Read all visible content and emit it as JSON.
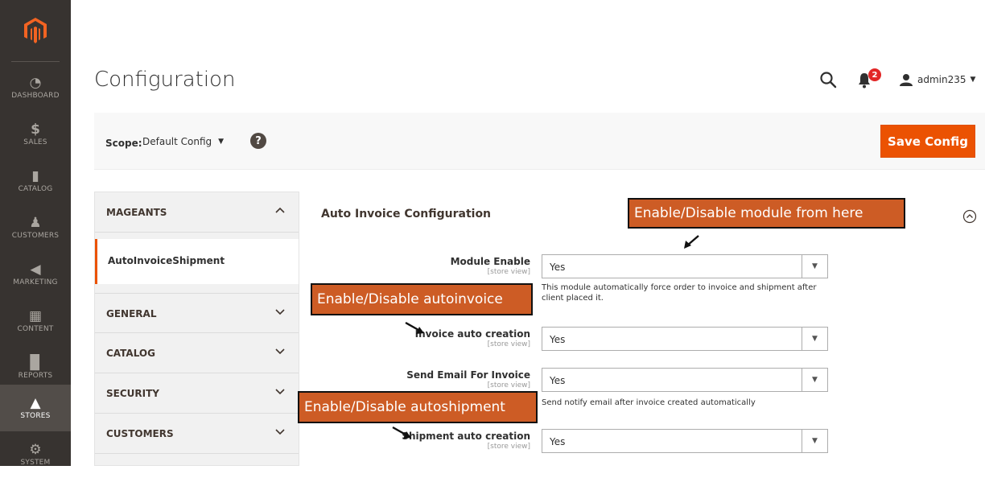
{
  "nav": {
    "items": [
      {
        "label": "DASHBOARD",
        "icon": "gauge-icon"
      },
      {
        "label": "SALES",
        "icon": "dollar-icon"
      },
      {
        "label": "CATALOG",
        "icon": "box-icon"
      },
      {
        "label": "CUSTOMERS",
        "icon": "person-icon"
      },
      {
        "label": "MARKETING",
        "icon": "megaphone-icon"
      },
      {
        "label": "CONTENT",
        "icon": "layout-icon"
      },
      {
        "label": "REPORTS",
        "icon": "bar-chart-icon"
      },
      {
        "label": "STORES",
        "icon": "storefront-icon"
      },
      {
        "label": "SYSTEM",
        "icon": "gear-icon"
      }
    ],
    "active_index": 7
  },
  "header": {
    "title": "Configuration",
    "notification_count": "2",
    "username": "admin235"
  },
  "scope": {
    "label": "Scope:",
    "value": "Default Config",
    "help_glyph": "?"
  },
  "toolbar": {
    "save_label": "Save Config"
  },
  "tabs": {
    "mageants": "MAGEANTS",
    "sub_item": "AutoInvoiceShipment",
    "general": "GENERAL",
    "catalog": "CATALOG",
    "security": "SECURITY",
    "customers": "CUSTOMERS"
  },
  "section": {
    "title": "Auto Invoice Configuration",
    "fields": [
      {
        "label": "Module Enable",
        "scope": "[store view]",
        "value": "Yes",
        "note": "This module automatically force order to invoice and shipment after client placed it."
      },
      {
        "label": "Invoice auto creation",
        "scope": "[store view]",
        "value": "Yes",
        "note": ""
      },
      {
        "label": "Send Email For Invoice",
        "scope": "[store view]",
        "value": "Yes",
        "note": "Send notify email after invoice created automatically"
      },
      {
        "label": "Shipment auto creation",
        "scope": "[store view]",
        "value": "Yes",
        "note": ""
      }
    ]
  },
  "annotations": {
    "module": "Enable/Disable module from here",
    "autoinvoice": "Enable/Disable autoinvoice",
    "autoshipment": "Enable/Disable autoshipment"
  },
  "colors": {
    "nav_bg": "#373330",
    "accent": "#eb5202",
    "callout": "#cd5c25"
  }
}
